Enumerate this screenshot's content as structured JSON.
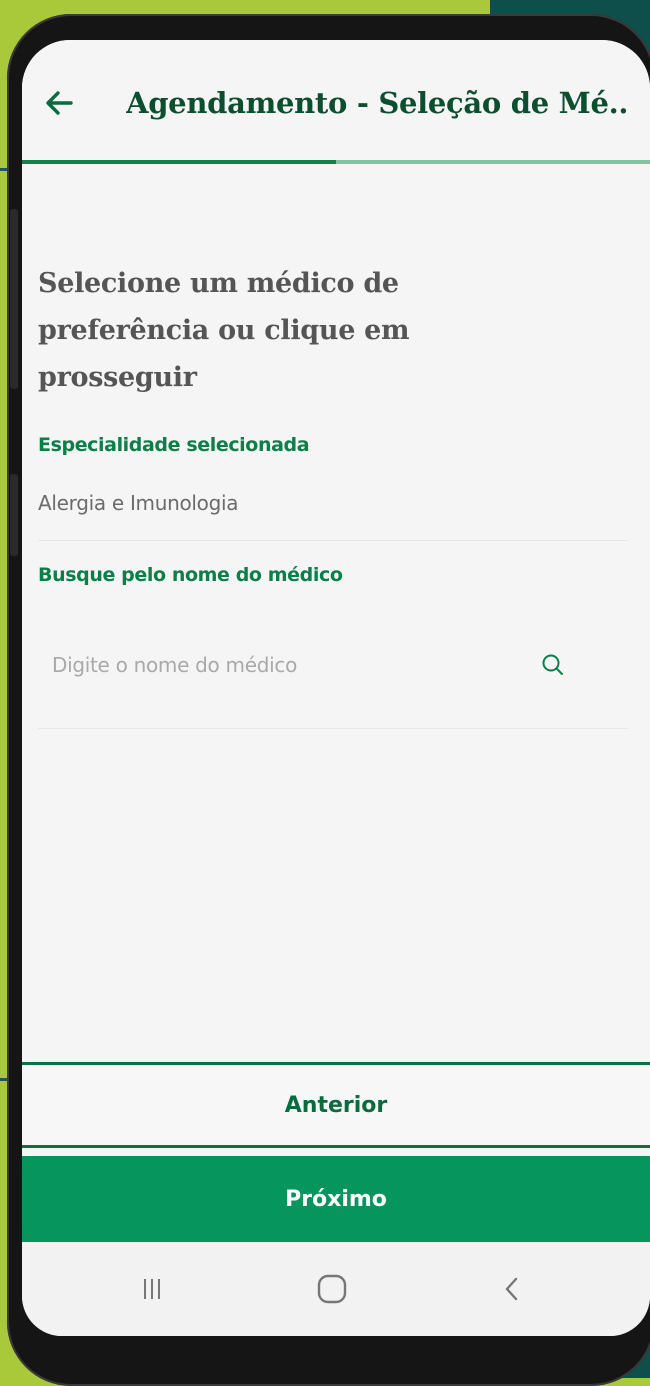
{
  "header": {
    "title": "Agendamento - Seleção de Mé..",
    "back_icon": "arrow-left-icon"
  },
  "progress": {
    "value_fraction": 0.5
  },
  "main": {
    "heading": "Selecione um médico de preferência ou clique em prosseguir",
    "specialty_label": "Especialidade selecionada",
    "specialty_value": "Alergia e Imunologia",
    "search_label": "Busque pelo nome do médico",
    "search_placeholder": "Digite o nome do médico",
    "search_icon": "search-icon"
  },
  "actions": {
    "previous_label": "Anterior",
    "next_label": "Próximo"
  },
  "colors": {
    "accent": "#06955c",
    "title": "#0b4f2e",
    "label": "#0a8048"
  },
  "system_nav": {
    "recent_icon": "recent-apps-icon",
    "home_icon": "home-icon",
    "back_icon": "nav-back-icon"
  }
}
